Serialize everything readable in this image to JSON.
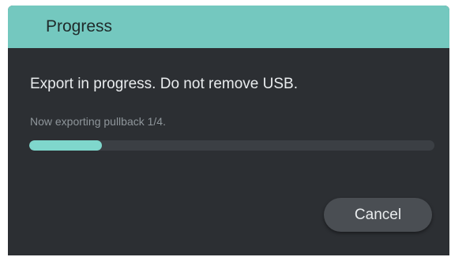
{
  "dialog": {
    "title": "Progress",
    "message": "Export in progress. Do not remove USB.",
    "status": "Now exporting pullback 1/4.",
    "progress": 0.18,
    "cancel_label": "Cancel"
  },
  "colors": {
    "header": "#74c8bf",
    "background": "#2c2f33",
    "progress_fill": "#7fd7cc",
    "progress_track": "#3b3f44",
    "button": "#4a4e53"
  }
}
